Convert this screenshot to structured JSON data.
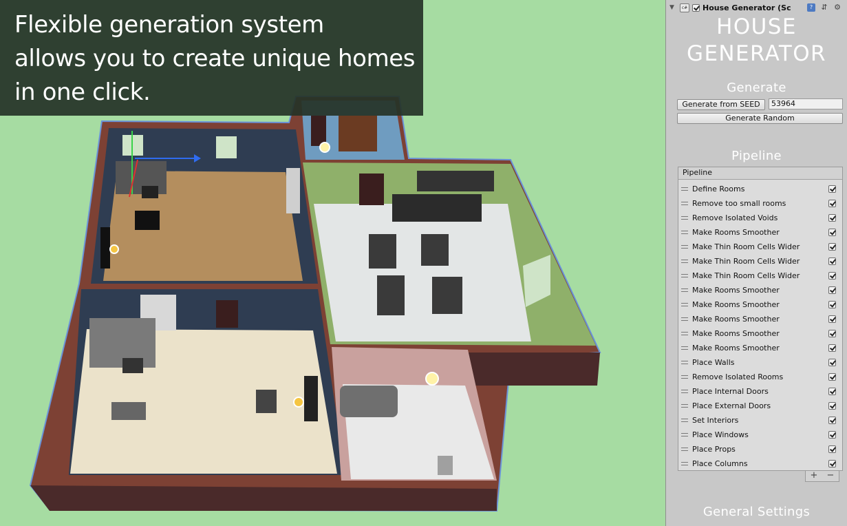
{
  "caption": {
    "lines": [
      "Flexible generation system",
      "allows you to create unique homes",
      "in one click."
    ]
  },
  "inspector": {
    "component_title": "House Generator (Sc",
    "script_icon_label": "c#",
    "title_line1": "HOUSE",
    "title_line2": "GENERATOR",
    "generate": {
      "section_title": "Generate",
      "from_seed_label": "Generate from SEED",
      "seed_value": "53964",
      "random_label": "Generate Random"
    },
    "pipeline": {
      "section_title": "Pipeline",
      "list_header": "Pipeline",
      "steps": [
        {
          "label": "Define Rooms",
          "checked": true
        },
        {
          "label": "Remove too small rooms",
          "checked": true
        },
        {
          "label": "Remove Isolated Voids",
          "checked": true
        },
        {
          "label": "Make Rooms Smoother",
          "checked": true
        },
        {
          "label": "Make Thin Room Cells Wider",
          "checked": true
        },
        {
          "label": "Make Thin Room Cells Wider",
          "checked": true
        },
        {
          "label": "Make Thin Room Cells Wider",
          "checked": true
        },
        {
          "label": "Make Rooms Smoother",
          "checked": true
        },
        {
          "label": "Make Rooms Smoother",
          "checked": true
        },
        {
          "label": "Make Rooms Smoother",
          "checked": true
        },
        {
          "label": "Make Rooms Smoother",
          "checked": true
        },
        {
          "label": "Make Rooms Smoother",
          "checked": true
        },
        {
          "label": "Place Walls",
          "checked": true
        },
        {
          "label": "Remove Isolated Rooms",
          "checked": true
        },
        {
          "label": "Place Internal Doors",
          "checked": true
        },
        {
          "label": "Place External Doors",
          "checked": true
        },
        {
          "label": "Set Interiors",
          "checked": true
        },
        {
          "label": "Place Windows",
          "checked": true
        },
        {
          "label": "Place Props",
          "checked": true
        },
        {
          "label": "Place Columns",
          "checked": true
        }
      ],
      "add_label": "+",
      "remove_label": "−"
    },
    "general_settings": {
      "section_title": "General Settings"
    }
  },
  "colors": {
    "background_green": "#a6dca2",
    "brick": "#8b4a3c",
    "wall_blue": "#3a4a5e",
    "wall_green": "#8fb36a",
    "wall_pink": "#cfa9a6"
  }
}
